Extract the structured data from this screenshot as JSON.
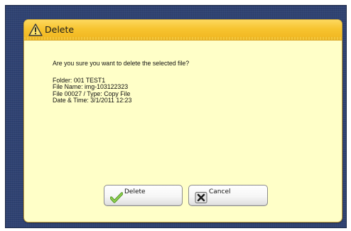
{
  "dialog": {
    "title": "Delete",
    "title_icon": "warning-triangle-icon",
    "message": "Are you sure you want to delete the selected file?",
    "details": {
      "folder": "Folder: 001 TEST1",
      "file_name": "File Name: img-103122323",
      "file_type": "File 00027 / Type: Copy File",
      "date_time": "Date & Time: 3/1/2011 12:23"
    },
    "buttons": {
      "delete_label": "Delete",
      "delete_icon": "checkmark-icon",
      "cancel_label": "Cancel",
      "cancel_icon": "x-icon"
    }
  },
  "colors": {
    "background": "#2f4272",
    "dialog_body": "#ffffc8",
    "titlebar": "#f7c430",
    "checkmark": "#7cbf3a"
  }
}
